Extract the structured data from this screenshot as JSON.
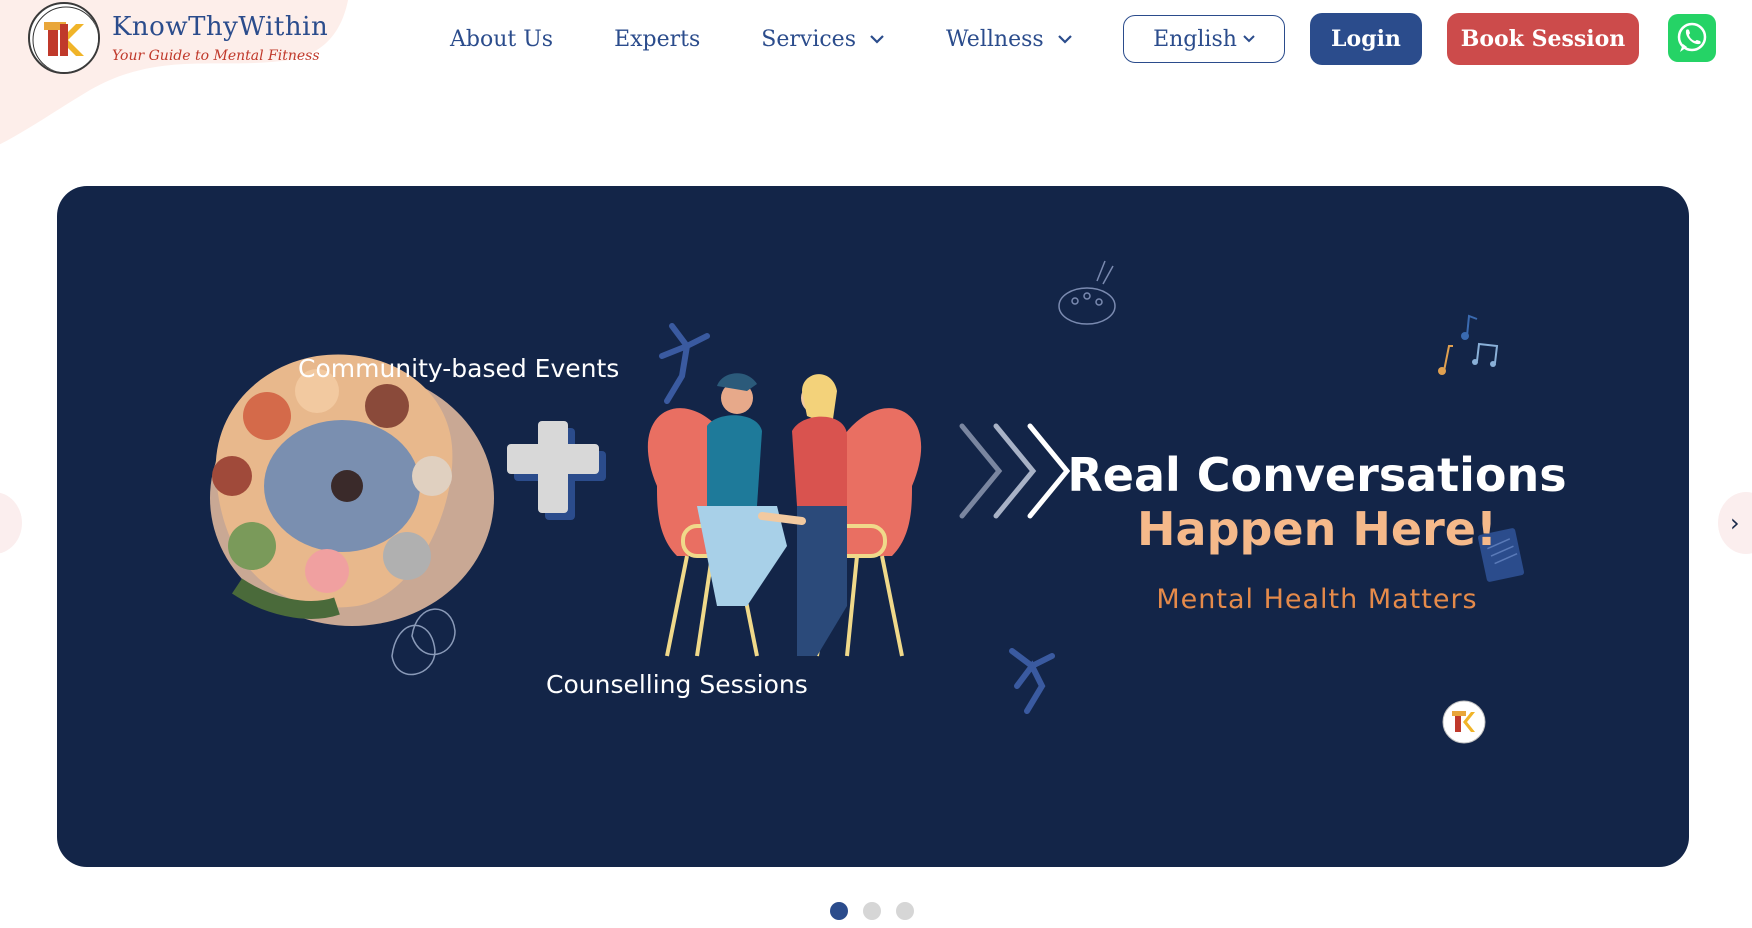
{
  "brand": {
    "name": "KnowThyWithin",
    "tagline": "Your Guide to Mental Fitness",
    "colors": {
      "primary": "#2b4c8c",
      "accent": "#cc4b4b",
      "banner": "#132548",
      "whatsapp": "#25d366"
    }
  },
  "nav": {
    "items": [
      {
        "label": "About Us",
        "dropdown": false
      },
      {
        "label": "Experts",
        "dropdown": false
      },
      {
        "label": "Services",
        "dropdown": true
      },
      {
        "label": "Wellness",
        "dropdown": true
      }
    ]
  },
  "header": {
    "language": "English",
    "login_label": "Login",
    "book_label": "Book Session",
    "whatsapp_icon": "whatsapp-icon"
  },
  "banner": {
    "community_label": "Community-based Events",
    "counselling_label": "Counselling Sessions",
    "headline_line1": "Real Conversations",
    "headline_line2": "Happen Here!",
    "subheadline": "Mental Health Matters"
  },
  "carousel": {
    "prev_glyph": "",
    "next_glyph": "›",
    "slide_count": 3,
    "active_slide": 1
  }
}
